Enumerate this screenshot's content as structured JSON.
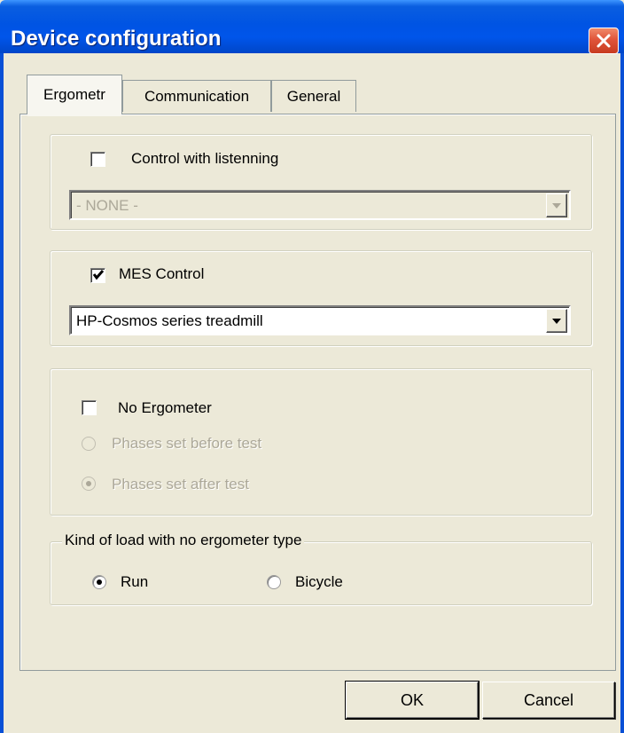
{
  "window": {
    "title": "Device configuration",
    "title_bar_color": "#0054e3",
    "close_icon": "close-icon"
  },
  "tabs": [
    {
      "label": "Ergometr",
      "active": true
    },
    {
      "label": "Communication",
      "active": false
    },
    {
      "label": "General",
      "active": false
    }
  ],
  "listening": {
    "checkbox_label": "Control with listenning",
    "checked": false,
    "enabled": true,
    "combo_value": "- NONE -",
    "combo_enabled": false
  },
  "mes": {
    "checkbox_label": "MES Control",
    "checked": true,
    "combo_value": "HP-Cosmos series treadmill"
  },
  "no_ergometer": {
    "checkbox_label": "No Ergometer",
    "checked": false,
    "options": [
      {
        "label": "Phases set before test",
        "selected": false,
        "enabled": false
      },
      {
        "label": "Phases set after test",
        "selected": true,
        "enabled": false
      }
    ]
  },
  "load_type": {
    "legend": "Kind of load with no ergometer type",
    "options": [
      {
        "label": "Run",
        "selected": true
      },
      {
        "label": "Bicycle",
        "selected": false
      }
    ]
  },
  "buttons": {
    "ok": "OK",
    "cancel": "Cancel"
  }
}
